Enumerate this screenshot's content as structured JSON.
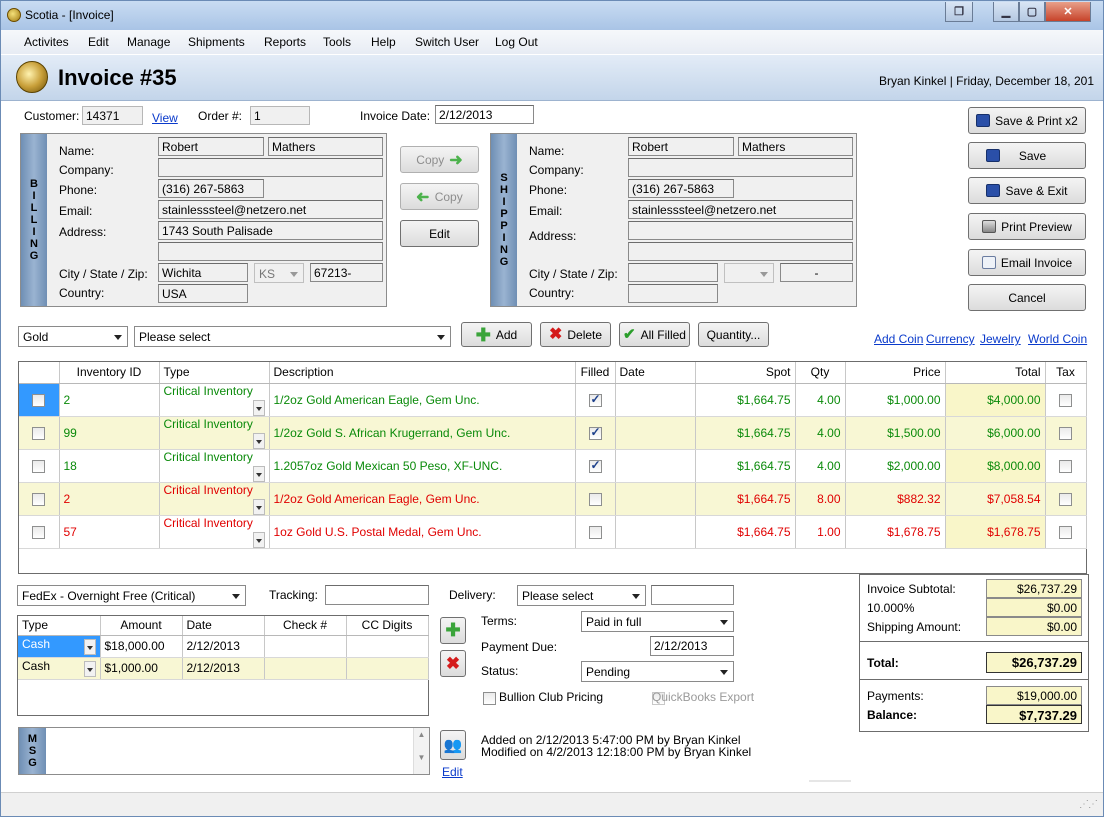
{
  "window": {
    "title": "Scotia - [Invoice]"
  },
  "menu": [
    "Activites",
    "Edit",
    "Manage",
    "Shipments",
    "Reports",
    "Tools",
    "Help",
    "Switch User",
    "Log Out"
  ],
  "header": {
    "title": "Invoice #35",
    "user_line": "Bryan Kinkel | Friday, December 18, 201"
  },
  "top": {
    "customer_label": "Customer:",
    "customer": "14371",
    "view_link": "View",
    "order_label": "Order #:",
    "order": "1",
    "date_label": "Invoice Date:",
    "date": "2/12/2013"
  },
  "billing": {
    "bar": "BILLING",
    "name_label": "Name:",
    "first": "Robert",
    "last": "Mathers",
    "company_label": "Company:",
    "company": "",
    "phone_label": "Phone:",
    "phone": "(316) 267-5863",
    "email_label": "Email:",
    "email": "stainlesssteel@netzero.net",
    "address_label": "Address:",
    "address1": "1743 South Palisade",
    "address2": "",
    "csz_label": "City / State / Zip:",
    "city": "Wichita",
    "state": "KS",
    "zip": "67213-",
    "country_label": "Country:",
    "country": "USA"
  },
  "shipping": {
    "bar": "SHIPPING",
    "name_label": "Name:",
    "first": "Robert",
    "last": "Mathers",
    "company_label": "Company:",
    "company": "",
    "phone_label": "Phone:",
    "phone": "(316) 267-5863",
    "email_label": "Email:",
    "email": "stainlesssteel@netzero.net",
    "address_label": "Address:",
    "address1": "",
    "address2": "",
    "csz_label": "City / State / Zip:",
    "city": "",
    "state": "",
    "zip": "-",
    "country_label": "Country:",
    "country": ""
  },
  "copy_buttons": {
    "copy_right": "Copy",
    "copy_left": "Copy",
    "edit": "Edit"
  },
  "side_buttons": {
    "save_print": "Save & Print x2",
    "save": "Save",
    "save_exit": "Save & Exit",
    "print_preview": "Print Preview",
    "email_invoice": "Email Invoice",
    "cancel": "Cancel"
  },
  "toolbar": {
    "metal": "Gold",
    "product": "Please select",
    "add": "Add",
    "delete": "Delete",
    "all_filled": "All Filled",
    "quantity": "Quantity...",
    "links": [
      "Add Coin",
      "Currency",
      "Jewelry",
      "World Coin"
    ]
  },
  "items": {
    "headers": [
      "Inventory ID",
      "Type",
      "Description",
      "Filled",
      "Date",
      "Spot",
      "Qty",
      "Price",
      "Total",
      "Tax"
    ],
    "rows": [
      {
        "id": "2",
        "type": "Critical Inventory",
        "desc": "1/2oz Gold American Eagle, Gem Unc.",
        "filled": true,
        "date": "",
        "spot": "$1,664.75",
        "qty": "4.00",
        "price": "$1,000.00",
        "total": "$4,000.00",
        "color": "green"
      },
      {
        "id": "99",
        "type": "Critical Inventory",
        "desc": "1/2oz Gold S. African Krugerrand, Gem Unc.",
        "filled": true,
        "date": "",
        "spot": "$1,664.75",
        "qty": "4.00",
        "price": "$1,500.00",
        "total": "$6,000.00",
        "color": "green"
      },
      {
        "id": "18",
        "type": "Critical Inventory",
        "desc": "1.2057oz Gold Mexican 50 Peso, XF-UNC.",
        "filled": true,
        "date": "",
        "spot": "$1,664.75",
        "qty": "4.00",
        "price": "$2,000.00",
        "total": "$8,000.00",
        "color": "green"
      },
      {
        "id": "2",
        "type": "Critical Inventory",
        "desc": "1/2oz Gold American Eagle, Gem Unc.",
        "filled": false,
        "date": "",
        "spot": "$1,664.75",
        "qty": "8.00",
        "price": "$882.32",
        "total": "$7,058.54",
        "color": "red"
      },
      {
        "id": "57",
        "type": "Critical Inventory",
        "desc": "1oz Gold U.S. Postal Medal, Gem Unc.",
        "filled": false,
        "date": "",
        "spot": "$1,664.75",
        "qty": "1.00",
        "price": "$1,678.75",
        "total": "$1,678.75",
        "color": "red"
      }
    ]
  },
  "shipping_opts": {
    "method": "FedEx - Overnight Free (Critical)",
    "tracking_label": "Tracking:",
    "tracking": "",
    "delivery_label": "Delivery:",
    "delivery": "Please select",
    "delivery_extra": ""
  },
  "payments": {
    "headers": [
      "Type",
      "Amount",
      "Date",
      "Check #",
      "CC Digits"
    ],
    "rows": [
      {
        "type": "Cash",
        "amount": "$18,000.00",
        "date": "2/12/2013",
        "check": "",
        "cc": ""
      },
      {
        "type": "Cash",
        "amount": "$1,000.00",
        "date": "2/12/2013",
        "check": "",
        "cc": ""
      }
    ]
  },
  "terms": {
    "terms_label": "Terms:",
    "terms": "Paid in full",
    "due_label": "Payment Due:",
    "due": "2/12/2013",
    "status_label": "Status:",
    "status": "Pending",
    "bullion": "Bullion Club Pricing",
    "quickbooks": "QuickBooks Export"
  },
  "totals": {
    "subtotal_label": "Invoice Subtotal:",
    "subtotal": "$26,737.29",
    "tax_label": "10.000%",
    "tax": "$0.00",
    "ship_label": "Shipping Amount:",
    "ship": "$0.00",
    "total_label": "Total:",
    "total": "$26,737.29",
    "payments_label": "Payments:",
    "payments": "$19,000.00",
    "balance_label": "Balance:",
    "balance": "$7,737.29"
  },
  "msg": {
    "bar": "MSG",
    "text": ""
  },
  "audit": {
    "added": "Added on 2/12/2013 5:47:00 PM by Bryan Kinkel",
    "modified": "Modified on 4/2/2013 12:18:00 PM by Bryan Kinkel",
    "edit_link": "Edit"
  },
  "colors": {
    "green": "#0a8a0a",
    "red": "#e00000",
    "highlight": "#f9f6c9",
    "accent": "#6f8fb4"
  }
}
